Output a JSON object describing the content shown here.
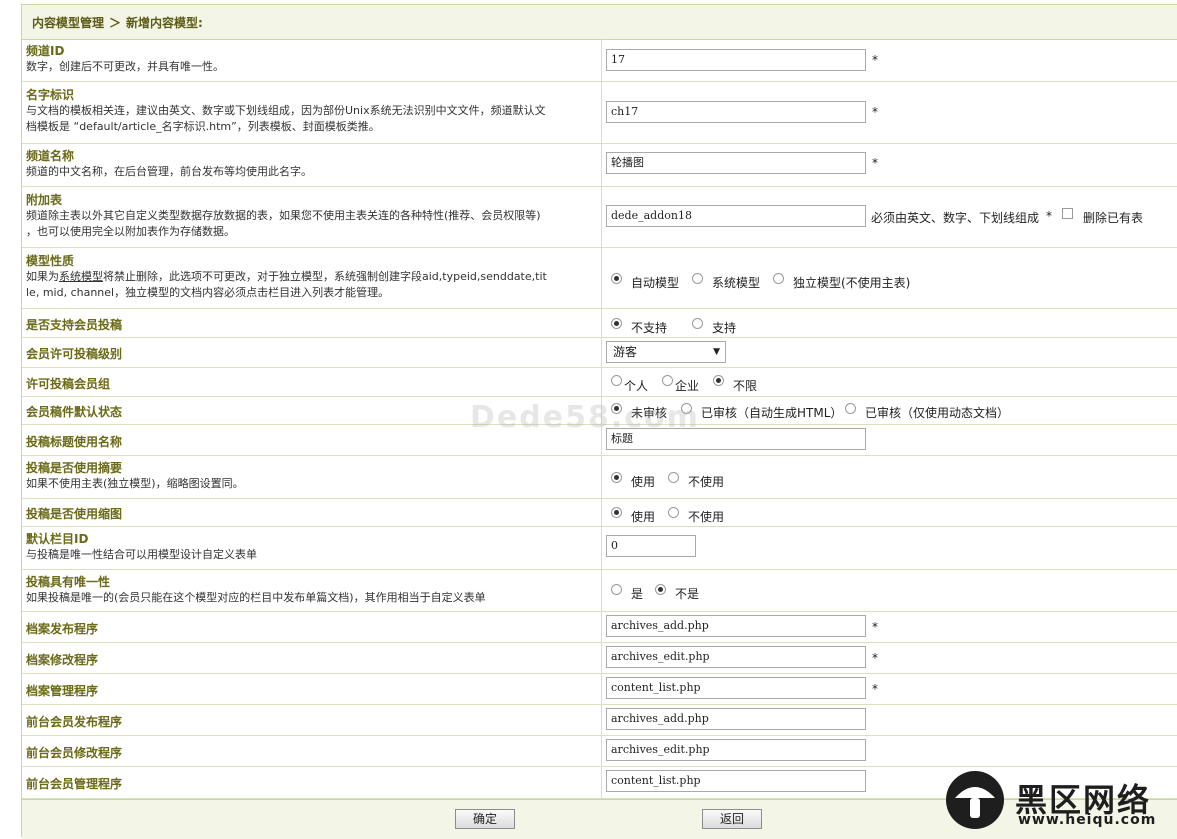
{
  "breadcrumb": {
    "root": "内容模型管理",
    "separator": "＞",
    "current": "新增内容模型:"
  },
  "fields": {
    "channel_id": {
      "label": "频道ID",
      "desc": "数字，创建后不可更改，并具有唯一性。",
      "value": "17",
      "star": "*"
    },
    "name_id": {
      "label": "名字标识",
      "desc1": "与文档的模板相关连，建议由英文、数字或下划线组成，因为部份Unix系统无法识别中文文件，频道默认文",
      "desc2": "档模板是 “default/article_名字标识.htm”，列表模板、封面模板类推。",
      "value": "ch17",
      "star": "*"
    },
    "channel_name": {
      "label": "频道名称",
      "desc": "频道的中文名称，在后台管理，前台发布等均使用此名字。",
      "value": "轮播图",
      "star": "*"
    },
    "addon_table": {
      "label": "附加表",
      "desc1": "频道除主表以外其它自定义类型数据存放数据的表，如果您不使用主表关连的各种特性(推荐、会员权限等)",
      "desc2": "，也可以使用完全以附加表作为存储数据。",
      "value": "dede_addon18",
      "note": "必须由英文、数字、下划线组成",
      "star": "*",
      "delete_label": "删除已有表"
    },
    "model_type": {
      "label": "模型性质",
      "desc1_a": "如果为",
      "desc1_link": "系统模型",
      "desc1_b": "将禁止删除，此选项不可更改，对于独立模型，系统强制创建字段aid,typeid,senddate,tit",
      "desc2": "le, mid, channel，独立模型的文档内容必须点击栏目进入列表才能管理。",
      "options": [
        "自动模型",
        "系统模型",
        "独立模型(不使用主表)"
      ]
    },
    "member_submit": {
      "label": "是否支持会员投稿",
      "options": [
        "不支持",
        "支持"
      ]
    },
    "member_level": {
      "label": "会员许可投稿级别",
      "selected": "游客"
    },
    "member_group": {
      "label": "许可投稿会员组",
      "options": [
        "个人",
        "企业",
        "不限"
      ]
    },
    "default_status": {
      "label": "会员稿件默认状态",
      "options": [
        "未审核",
        "已审核（自动生成HTML）",
        "已审核（仅使用动态文档）"
      ]
    },
    "title_name": {
      "label": "投稿标题使用名称",
      "value": "标题"
    },
    "use_summary": {
      "label": "投稿是否使用摘要",
      "desc": "如果不使用主表(独立模型)，缩略图设置同。",
      "options": [
        "使用",
        "不使用"
      ]
    },
    "use_thumb": {
      "label": "投稿是否使用缩图",
      "options": [
        "使用",
        "不使用"
      ]
    },
    "default_cat": {
      "label": "默认栏目ID",
      "desc": "与投稿是唯一性结合可以用模型设计自定义表单",
      "value": "0"
    },
    "unique": {
      "label": "投稿具有唯一性",
      "desc": "如果投稿是唯一的(会员只能在这个模型对应的栏目中发布单篇文档)，其作用相当于自定义表单",
      "options": [
        "是",
        "不是"
      ]
    },
    "add_prog": {
      "label": "档案发布程序",
      "value": "archives_add.php",
      "star": "*"
    },
    "edit_prog": {
      "label": "档案修改程序",
      "value": "archives_edit.php",
      "star": "*"
    },
    "list_prog": {
      "label": "档案管理程序",
      "value": "content_list.php",
      "star": "*"
    },
    "m_add_prog": {
      "label": "前台会员发布程序",
      "value": "archives_add.php"
    },
    "m_edit_prog": {
      "label": "前台会员修改程序",
      "value": "archives_edit.php"
    },
    "m_list_prog": {
      "label": "前台会员管理程序",
      "value": "content_list.php"
    }
  },
  "buttons": {
    "ok": "确定",
    "back": "返回"
  },
  "watermark": "Dede58.com",
  "logo": {
    "name": "黑区网络",
    "url": "www.heiqu.com"
  },
  "colors": {
    "label": "#6a6a18",
    "border": "#d8e2bd",
    "header_bg": "#f3f5e7"
  }
}
